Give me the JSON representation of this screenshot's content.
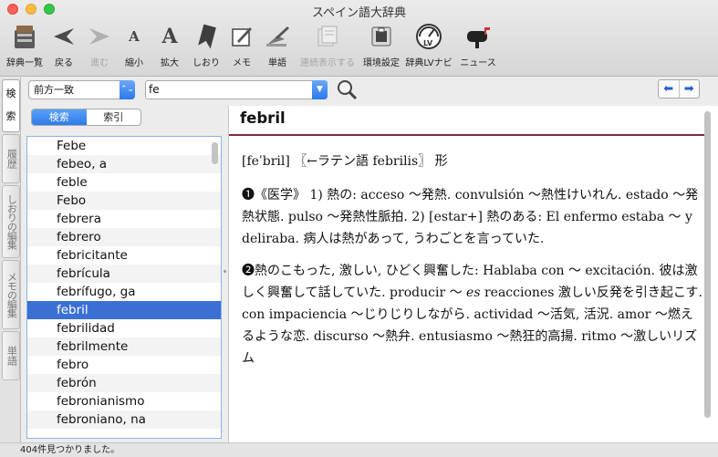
{
  "window": {
    "title": "スペイン語大辞典"
  },
  "toolbar": {
    "items": [
      {
        "label": "辞典一覧",
        "icon": "books-icon"
      },
      {
        "label": "戻る",
        "icon": "back-arrow-icon"
      },
      {
        "label": "進む",
        "icon": "forward-arrow-icon"
      },
      {
        "label": "縮小",
        "icon": "text-smaller-icon"
      },
      {
        "label": "拡大",
        "icon": "text-larger-icon"
      },
      {
        "label": "しおり",
        "icon": "bookmark-icon"
      },
      {
        "label": "メモ",
        "icon": "memo-icon"
      },
      {
        "label": "単語",
        "icon": "word-icon"
      },
      {
        "label": "連続表示する",
        "icon": "continuous-display-icon"
      },
      {
        "label": "環境設定",
        "icon": "preferences-icon"
      },
      {
        "label": "辞典LVナビ",
        "icon": "lv-navi-icon"
      },
      {
        "label": "ニュース",
        "icon": "mailbox-icon"
      }
    ],
    "glyphs": {
      "forward": "➤",
      "smaller": "A",
      "larger": "A"
    }
  },
  "sidebar_tabs": [
    {
      "label": "検"
    },
    {
      "label": "索"
    },
    {
      "label": "履歴"
    },
    {
      "label": "しおりの編集"
    },
    {
      "label": "メモの編集"
    },
    {
      "label": "単語"
    }
  ],
  "search": {
    "mode_selected": "前方一致",
    "query": "fe",
    "nav_back": "⬅",
    "nav_forward": "➡"
  },
  "segment": {
    "search_label": "検索",
    "index_label": "索引"
  },
  "word_list": [
    "Febe",
    "febeo, a",
    "feble",
    "Febo",
    "febrera",
    "febrero",
    "febricitante",
    "febrícula",
    "febrífugo, ga",
    "febril",
    "febrilidad",
    "febrilmente",
    "febro",
    "febrón",
    "febronianismo",
    "febroniano, na"
  ],
  "selected_word": "febril",
  "entry": {
    "headword": "febril",
    "etymology": "[feˈbril] 〖←ラテン語 febrilis〗 形",
    "sense1_marker": "❶",
    "sense1_text": "《医学》 1) 熱の: acceso ～発熱. convulsión ～熱性けいれん. estado ～発熱状態. pulso ～発熱性脈拍. 2) [estar+] 熱のある: El enfermo estaba ～ y deliraba. 病人は熱があって, うわごとを言っていた.",
    "sense2_marker": "❷",
    "sense2_text_a": "熱のこもった, 激しい, ひどく興奮した: Hablaba con ～ excitación. 彼は激しく興奮して話していた. producir ～ ",
    "sense2_italic": "es",
    "sense2_text_b": " reacciones 激しい反発を引き起こす. con impaciencia ～じりじりしながら. actividad ～活気, 活況. amor ～燃えるような恋. discurso ～熱弁. entusiasmo ～熱狂的高揚. ritmo ～激しいリズム"
  },
  "status": {
    "text": "404件見つかりました。"
  },
  "colors": {
    "accent": "#2f7bec",
    "selection": "#3b6fd4",
    "rule": "#7b2d47"
  }
}
